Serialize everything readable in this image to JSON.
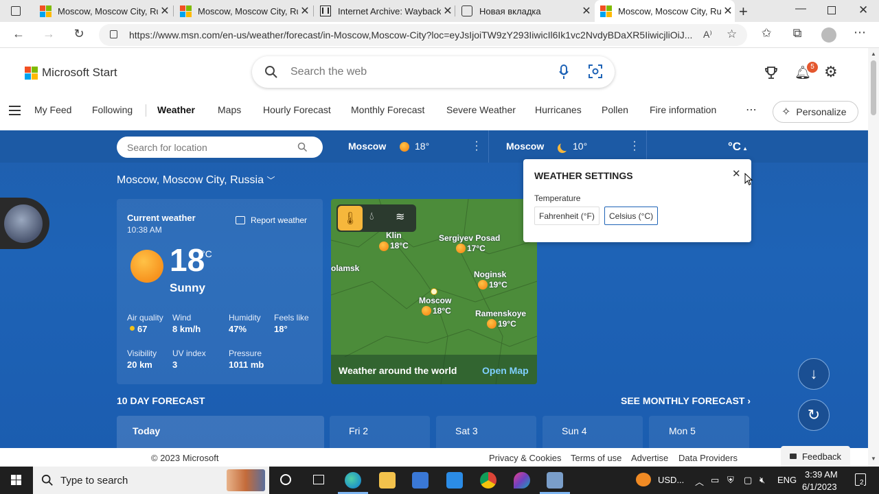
{
  "browser": {
    "tabs": [
      {
        "title": "Moscow, Moscow City, Ru",
        "favicon": "msn-icon",
        "active": false
      },
      {
        "title": "Moscow, Moscow City, Ru",
        "favicon": "msn-icon",
        "active": false
      },
      {
        "title": "Internet Archive: Wayback",
        "favicon": "archive-icon",
        "active": false
      },
      {
        "title": "Новая вкладка",
        "favicon": "new-tab-icon",
        "active": false
      },
      {
        "title": "Moscow, Moscow City, Ru",
        "favicon": "msn-icon",
        "active": true
      }
    ],
    "url": "https://www.msn.com/en-us/weather/forecast/in-Moscow,Moscow-City?loc=eyJsIjoiTW9zY293IiwicIl6Ik1vc2NvdyBDaXR5IiwicjliOiJ..."
  },
  "header": {
    "brand": "Microsoft Start",
    "search_placeholder": "Search the web",
    "notification_count": "5",
    "nav": [
      "My Feed",
      "Following",
      "Weather",
      "Maps",
      "Hourly Forecast",
      "Monthly Forecast",
      "Severe Weather",
      "Hurricanes",
      "Pollen",
      "Fire information"
    ],
    "more": "⋯",
    "personalize": "Personalize"
  },
  "weather_bar": {
    "location_placeholder": "Search for location",
    "fav1": {
      "city": "Moscow",
      "temp": "18°",
      "icon": "sun-icon"
    },
    "fav2": {
      "city": "Moscow",
      "temp": "10°",
      "icon": "moon-icon"
    },
    "unit": "°C"
  },
  "location_title": "Moscow, Moscow City, Russia",
  "current": {
    "heading": "Current weather",
    "time": "10:38 AM",
    "report": "Report weather",
    "temp": "18",
    "unit": "°C",
    "condition": "Sunny",
    "stats": [
      {
        "label": "Air quality",
        "value": "67"
      },
      {
        "label": "Wind",
        "value": "8 km/h"
      },
      {
        "label": "Humidity",
        "value": "47%"
      },
      {
        "label": "Feels like",
        "value": "18°"
      },
      {
        "label": "Visibility",
        "value": "20 km"
      },
      {
        "label": "UV index",
        "value": "3"
      },
      {
        "label": "Pressure",
        "value": "1011 mb"
      }
    ]
  },
  "map": {
    "labels": [
      {
        "name": "Klin",
        "temp": "18°C"
      },
      {
        "name": "Sergiyev Posad",
        "temp": "17°C"
      },
      {
        "name": "olamsk",
        "temp": ""
      },
      {
        "name": "Noginsk",
        "temp": "19°C"
      },
      {
        "name": "Moscow",
        "temp": "18°C"
      },
      {
        "name": "Ramenskoye",
        "temp": "19°C"
      }
    ],
    "footer": "Weather around the world",
    "open": "Open Map"
  },
  "settings": {
    "title": "WEATHER SETTINGS",
    "label": "Temperature",
    "fahrenheit": "Fahrenheit (°F)",
    "celsius": "Celsius (°C)"
  },
  "forecast": {
    "heading": "10 DAY FORECAST",
    "more": "SEE MONTHLY FORECAST",
    "days": [
      "Today",
      "Fri 2",
      "Sat 3",
      "Sun 4",
      "Mon 5"
    ]
  },
  "footer": {
    "copyright": "© 2023 Microsoft",
    "links": [
      "Privacy & Cookies",
      "Terms of use",
      "Advertise",
      "Data Providers"
    ],
    "feedback": "Feedback"
  },
  "taskbar": {
    "search_placeholder": "Type to search",
    "weather_tray": "USD...",
    "lang": "ENG",
    "time": "3:39 AM",
    "date": "6/1/2023",
    "notifications": "2"
  }
}
